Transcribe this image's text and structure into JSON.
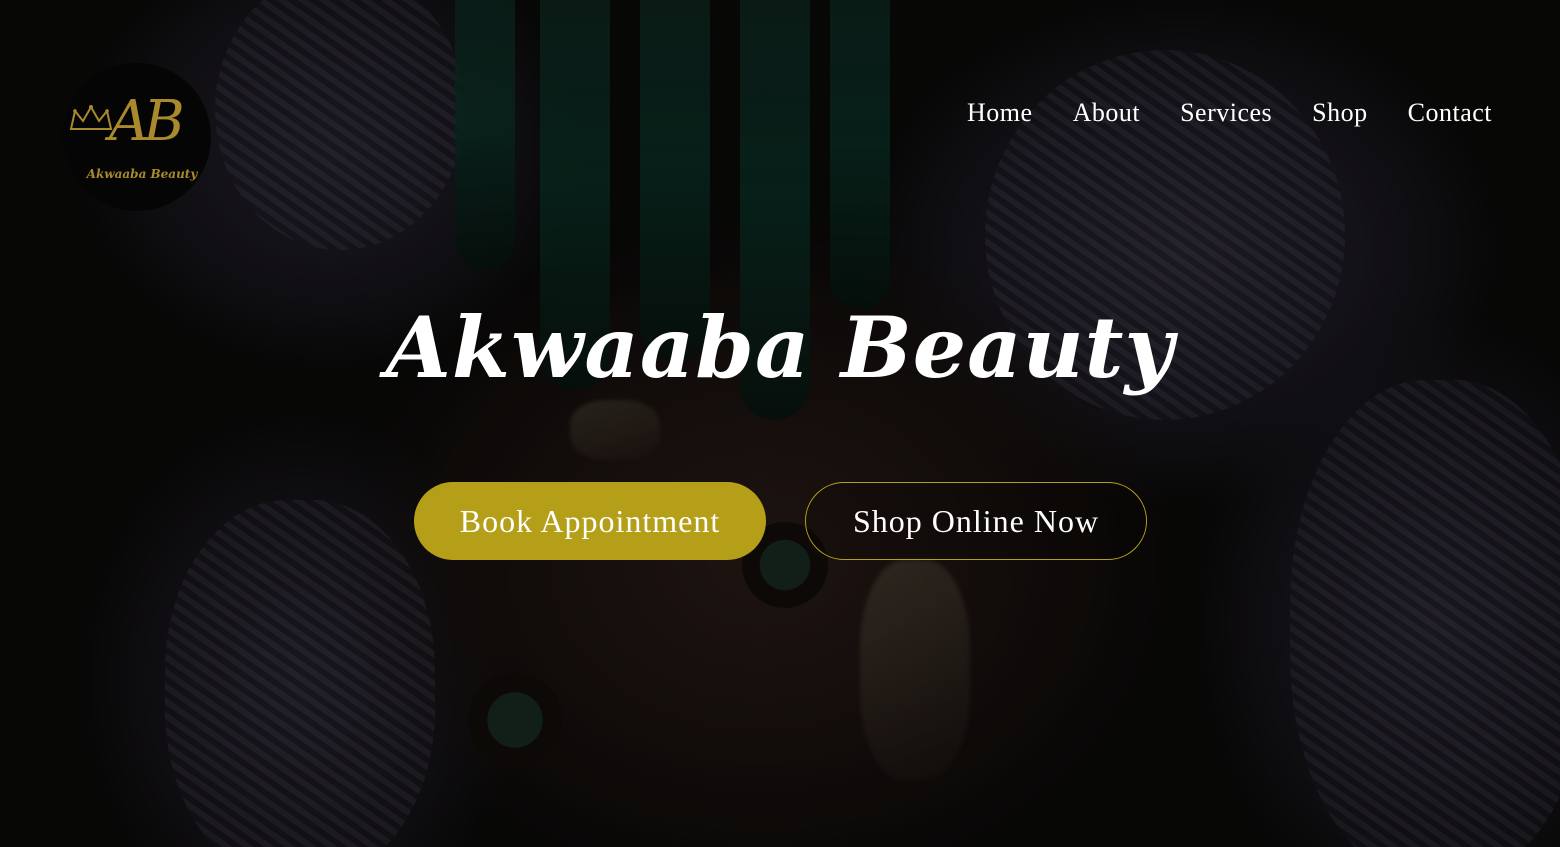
{
  "brand": {
    "logo_monogram": "AB",
    "logo_subtitle": "Akwaaba Beauty",
    "gold_color": "#b59f18"
  },
  "nav": {
    "items": [
      {
        "label": "Home"
      },
      {
        "label": "About"
      },
      {
        "label": "Services"
      },
      {
        "label": "Shop"
      },
      {
        "label": "Contact"
      }
    ]
  },
  "hero": {
    "title": "Akwaaba Beauty",
    "primary_button": "Book Appointment",
    "secondary_button": "Shop Online Now"
  }
}
